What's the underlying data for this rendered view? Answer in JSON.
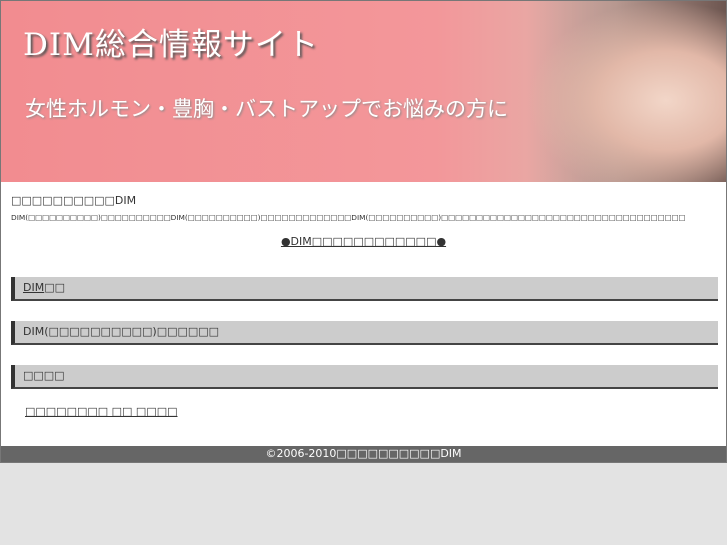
{
  "banner": {
    "title": "DIM総合情報サイト",
    "subtitle": "女性ホルモン・豊胸・バストアップでお悩みの方に"
  },
  "intro": {
    "line1": "□□□□□□□□□□DIM",
    "line2": "DIM(□□□□□□□□□□)□□□□□□□□□□DIM(□□□□□□□□□□)□□□□□□□□□□□□□DIM(□□□□□□□□□□)□□□□□□□□□□□□□□□□□□□□□□□□□□□□□□□□□□□"
  },
  "main_link": "●DIM□□□□□□□□□□□□●",
  "sections": [
    {
      "link": "DIM",
      "rest": "□□"
    },
    {
      "label": "DIM(□□□□□□□□□□)□□□□□□"
    },
    {
      "label": "□□□□"
    }
  ],
  "bottom_link": "□□□□□□□□ □□ □□□□",
  "footer": "©2006-2010□□□□□□□□□□DIM"
}
